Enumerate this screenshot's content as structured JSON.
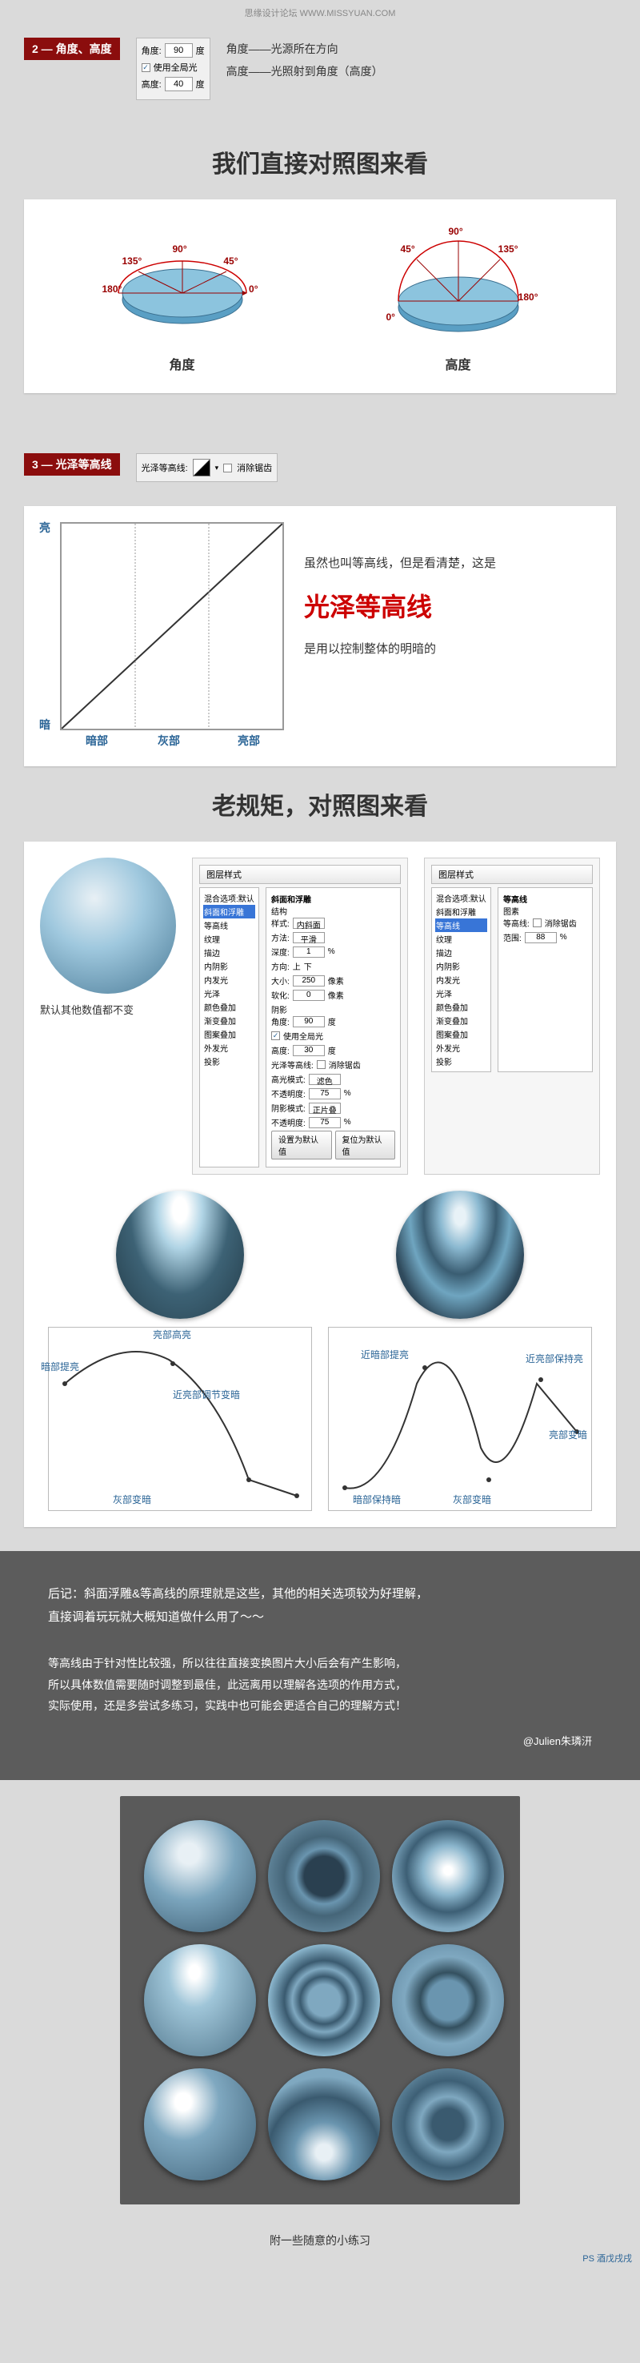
{
  "watermark": "思缘设计论坛   WWW.MISSYUAN.COM",
  "section2": {
    "tag": "2 — 角度、高度",
    "angle_label": "角度:",
    "angle_value": "90",
    "angle_unit": "度",
    "global_light": "使用全局光",
    "altitude_label": "高度:",
    "altitude_value": "40",
    "altitude_unit": "度",
    "desc1": "角度——光源所在方向",
    "desc2": "高度——光照射到角度（高度）"
  },
  "title1": "我们直接对照图来看",
  "diagram": {
    "angles": {
      "a0": "0°",
      "a45": "45°",
      "a90": "90°",
      "a135": "135°",
      "a180": "180°"
    },
    "label_left": "角度",
    "label_right": "高度"
  },
  "section3": {
    "tag": "3 — 光泽等高线",
    "contour_label": "光泽等高线:",
    "antialias": "消除锯齿"
  },
  "curve": {
    "y_bright": "亮",
    "y_dark": "暗",
    "x_dark": "暗部",
    "x_gray": "灰部",
    "x_bright": "亮部",
    "text1": "虽然也叫等高线，但是看清楚，这是",
    "highlight": "光泽等高线",
    "text2": "是用以控制整体的明暗的"
  },
  "title2": "老规矩，对照图来看",
  "compare": {
    "note": "默认其他数值都不变",
    "dialog_title": "图层样式",
    "styles": {
      "blend": "混合选项:默认",
      "bevel": "斜面和浮雕",
      "contour": "等高线",
      "texture": "纹理",
      "stroke": "描边",
      "inner_shadow": "内阴影",
      "inner_glow": "内发光",
      "satin": "光泽",
      "color_overlay": "颜色叠加",
      "grad_overlay": "渐变叠加",
      "pattern": "图案叠加",
      "outer_glow": "外发光",
      "drop_shadow": "投影"
    },
    "panel1": {
      "header": "斜面和浮雕",
      "group_struct": "结构",
      "style_lbl": "样式:",
      "style_val": "内斜面",
      "method_lbl": "方法:",
      "method_val": "平滑",
      "depth": "深度:",
      "depth_val": "1",
      "depth_pct": "%",
      "dir": "方向:",
      "dir_up": "上",
      "dir_down": "下",
      "size": "大小:",
      "size_val": "250",
      "size_unit": "像素",
      "soften": "软化:",
      "soften_val": "0",
      "soften_unit": "像素",
      "group_shade": "阴影",
      "angle": "角度:",
      "angle_val": "90",
      "angle_unit": "度",
      "global": "使用全局光",
      "alt": "高度:",
      "alt_val": "30",
      "alt_unit": "度",
      "gloss": "光泽等高线:",
      "aa": "消除锯齿",
      "hilite": "高光模式:",
      "hilite_val": "滤色",
      "opacity": "不透明度:",
      "op_val": "75",
      "pct": "%",
      "shadow": "阴影模式:",
      "shadow_val": "正片叠底",
      "btn_default": "设置为默认值",
      "btn_reset": "复位为默认值"
    },
    "panel2": {
      "header": "等高线",
      "group": "图素",
      "contour": "等高线:",
      "aa": "消除锯齿",
      "range": "范围:",
      "range_val": "88",
      "pct": "%"
    }
  },
  "labels_left": {
    "l1": "亮部高亮",
    "l2": "暗部提亮",
    "l3": "近亮部调节变暗",
    "l4": "灰部变暗"
  },
  "labels_right": {
    "r1": "近亮部保持亮",
    "r2": "近暗部提亮",
    "r3": "亮部变暗",
    "r4": "暗部保持暗",
    "r5": "灰部变暗"
  },
  "footer": {
    "p1a": "后记：斜面浮雕&等高线的原理就是这些，其他的相关选项较为好理解，",
    "p1b": "直接调着玩玩就大概知道做什么用了～～",
    "p2a": "等高线由于针对性比较强，所以往往直接变换图片大小后会有产生影响，",
    "p2b": "所以具体数值需要随时调整到最佳，此远离用以理解各选项的作用方式，",
    "p2c": "实际使用，还是多尝试多练习，实践中也可能会更适合自己的理解方式！",
    "sig": "@Julien朱璘汧"
  },
  "final_caption": "附一些随意的小练习",
  "bottom_logo": "PS 酒戊戌戌"
}
